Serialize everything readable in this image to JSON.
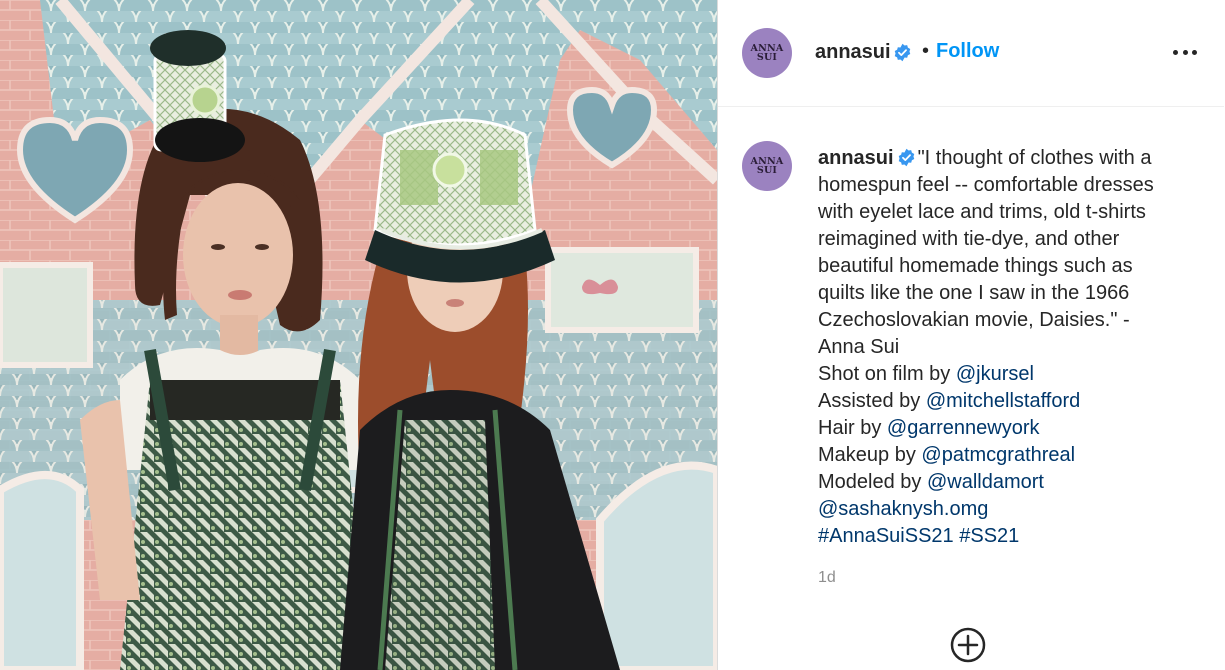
{
  "post": {
    "image_alt": "Two models in crochet bucket hats in front of a pink gingerbread-style painted house backdrop"
  },
  "header": {
    "avatar_text_top": "ANNA",
    "avatar_text_bottom": "SUI",
    "username": "annasui",
    "separator": "•",
    "follow_label": "Follow",
    "more_icon": "more-horizontal-icon",
    "verified_color": "#3897f0"
  },
  "caption": {
    "username": "annasui",
    "quote_lines": [
      "\"I thought of clothes with a",
      "homespun feel -- comfortable dresses",
      "with eyelet lace and trims, old t-shirts",
      "reimagined with tie-dye, and other",
      "beautiful homemade things such as",
      "quilts like the one I saw in the 1966",
      "Czechoslovakian movie, Daisies.\" -",
      "Anna Sui"
    ],
    "credits": [
      {
        "prefix": "Shot on film by ",
        "handle": "@jkursel"
      },
      {
        "prefix": "Assisted by ",
        "handle": "@mitchellstafford"
      },
      {
        "prefix": "Hair by ",
        "handle": "@garrennewyork"
      },
      {
        "prefix": "Makeup by ",
        "handle": "@patmcgrathreal"
      },
      {
        "prefix": "Modeled by ",
        "handle": "@walldamort"
      },
      {
        "prefix": "",
        "handle": "@sashaknysh.omg"
      }
    ],
    "hashtags": [
      "#AnnaSuiSS21",
      "#SS21"
    ]
  },
  "timestamp": "1d",
  "add_comment_icon": "plus-circle-icon",
  "colors": {
    "link": "#00376b",
    "follow": "#0095f6",
    "muted": "#8e8e8e",
    "avatar_bg": "#9b82c0"
  }
}
